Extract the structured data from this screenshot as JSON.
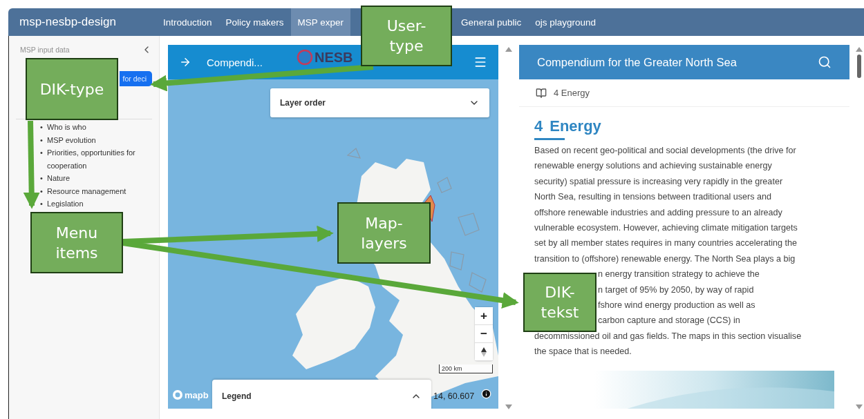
{
  "app_bar": {
    "title": "msp-nesbp-design",
    "nav": [
      {
        "label": "Introduction",
        "selected": false
      },
      {
        "label": "Policy makers",
        "selected": false
      },
      {
        "label": "MSP exper",
        "selected": true
      },
      {
        "label": "General public",
        "selected": false
      },
      {
        "label": "ojs playground",
        "selected": false
      }
    ]
  },
  "sidebar": {
    "sections": [
      {
        "label": "MSP input data",
        "selected": false
      },
      {
        "label": "for deci",
        "selected": true
      }
    ],
    "menu_items": [
      {
        "bullet": "•",
        "label": "Who is who"
      },
      {
        "bullet": "•",
        "label": "MSP evolution"
      },
      {
        "bullet": "•",
        "label": "Priorities, opportunities for cooperation"
      },
      {
        "bullet": "•",
        "label": "Nature"
      },
      {
        "bullet": "•",
        "label": "Resource management"
      },
      {
        "bullet": "•",
        "label": "Legislation"
      }
    ]
  },
  "map_panel": {
    "title": "Compendi...",
    "logo": "NESB",
    "layer_order": "Layer order",
    "zoom_in": "+",
    "zoom_out": "−",
    "scale": "200 km",
    "attribution": "mapb",
    "coordinates": "14, 60.607",
    "legend": "Legend"
  },
  "document": {
    "title": "Compendium for the Greater North Sea",
    "breadcrumb": "4 Energy",
    "heading_number": "4",
    "heading": "Energy",
    "lines": [
      {
        "kind": "full",
        "text": "Based on recent geo-political and social developments (the drive for"
      },
      {
        "kind": "full",
        "text": "renewable energy solutions and achieving sustainable energy"
      },
      {
        "kind": "full",
        "text": "security) spatial pressure is increasing very rapidly in the greater"
      },
      {
        "kind": "full",
        "text": "North Sea, resulting in tensions between traditional users and"
      },
      {
        "kind": "full",
        "text": "offshore renewable industries and adding pressure to an already"
      },
      {
        "kind": "full",
        "text": "vulnerable ecosystem. However, achieving climate mitigation targets"
      },
      {
        "kind": "full",
        "text": "set by all member states requires in many countries accelerating the"
      },
      {
        "kind": "full",
        "text": "transition to (offshore) renewable energy. The North Sea plays a big"
      },
      {
        "kind": "partial",
        "text": "n energy transition strategy to achieve the"
      },
      {
        "kind": "partial",
        "text": "n target of 95% by 2050, by way of rapid"
      },
      {
        "kind": "partial",
        "text": "fshore wind energy production as well as"
      },
      {
        "kind": "partial",
        "text": "carbon capture and storage (CCS) in"
      },
      {
        "kind": "full",
        "text": "decommissioned oil and gas fields. The maps in this section visualise"
      },
      {
        "kind": "full",
        "text": "the space that is needed."
      }
    ]
  },
  "annotations": [
    {
      "label": "User-type"
    },
    {
      "label": "DIK-type"
    },
    {
      "label": "Menu items"
    },
    {
      "label": "Map-layers"
    },
    {
      "label": "DIK-tekst"
    }
  ]
}
